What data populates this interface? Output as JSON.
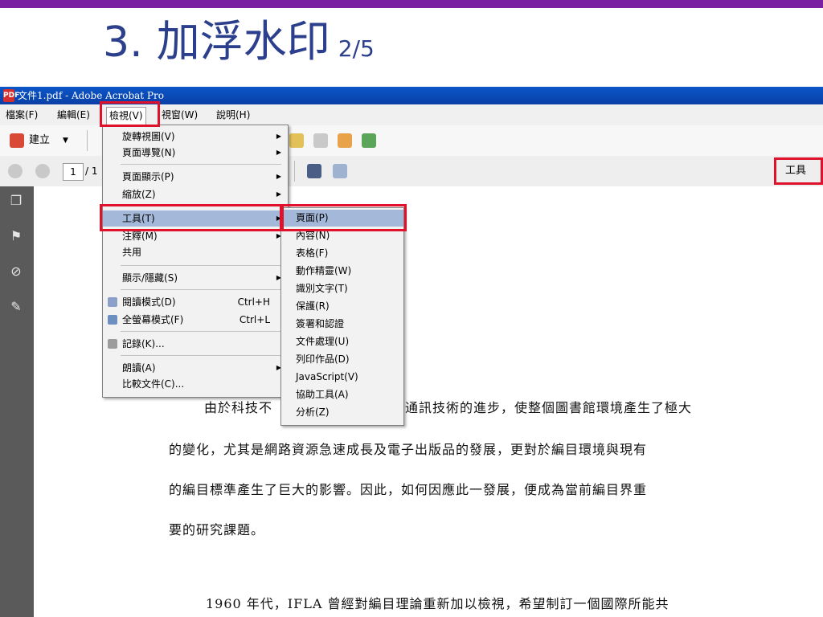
{
  "slide": {
    "title_num": "3.",
    "title_text": "加浮水印",
    "page": "2/5"
  },
  "window": {
    "title": "文件1.pdf - Adobe Acrobat Pro",
    "pdf_glyph": "PDF"
  },
  "menubar": [
    {
      "label": "檔案(F)"
    },
    {
      "label": "編輯(E)"
    },
    {
      "label": "檢視(V)"
    },
    {
      "label": "視窗(W)"
    },
    {
      "label": "說明(H)"
    }
  ],
  "toolbar": {
    "create_label": "建立",
    "page_number": "1",
    "page_total": "/ 1",
    "tools_label": "工具"
  },
  "view_menu": [
    {
      "label": "旋轉視圖(V)",
      "arrow": "▶"
    },
    {
      "label": "頁面導覽(N)",
      "arrow": "▶"
    },
    {
      "label": "頁面顯示(P)",
      "arrow": "▶"
    },
    {
      "label": "縮放(Z)",
      "arrow": "▶"
    },
    {
      "label": "工具(T)",
      "arrow": "▶"
    },
    {
      "label": "注釋(M)",
      "arrow": "▶"
    },
    {
      "label": "共用"
    },
    {
      "label": "顯示/隱藏(S)",
      "arrow": "▶"
    },
    {
      "label": "閱讀模式(D)",
      "shortcut": "Ctrl+H"
    },
    {
      "label": "全螢幕模式(F)",
      "shortcut": "Ctrl+L"
    },
    {
      "label": "記錄(K)..."
    },
    {
      "label": "朗讀(A)",
      "arrow": "▶"
    },
    {
      "label": "比較文件(C)..."
    }
  ],
  "tools_submenu": [
    {
      "label": "頁面(P)"
    },
    {
      "label": "內容(N)"
    },
    {
      "label": "表格(F)"
    },
    {
      "label": "動作精靈(W)"
    },
    {
      "label": "識別文字(T)"
    },
    {
      "label": "保護(R)"
    },
    {
      "label": "簽署和認證"
    },
    {
      "label": "文件處理(U)"
    },
    {
      "label": "列印作品(D)"
    },
    {
      "label": "JavaScript(V)"
    },
    {
      "label": "協助工具(A)"
    },
    {
      "label": "分析(Z)"
    }
  ],
  "document": {
    "line1_start": "由於科技不",
    "line1_end": "通訊技術的進步，使整個圖書館環境產生了極大",
    "line2": "的變化，尤其是網路資源急速成長及電子出版品的發展，更對於編目環境與現有",
    "line3": "的編目標準產生了巨大的影響。因此，如何因應此一發展，便成為當前編目界重",
    "line4": "要的研究課題。",
    "line5": "1960 年代，IFLA 曾經對編目理論重新加以檢視，希望制訂一個國際所能共"
  },
  "colors": {
    "accent": "#7b1fa2",
    "title": "#2b3f8c",
    "highlight_box": "#e0112b",
    "menu_highlight": "#a4b8d9"
  },
  "icons": [
    "create-icon",
    "nav-up-icon",
    "nav-down-icon",
    "save-icon",
    "fit-page-icon",
    "pages-panel-icon",
    "bookmark-panel-icon",
    "attachment-panel-icon",
    "signature-panel-icon"
  ]
}
